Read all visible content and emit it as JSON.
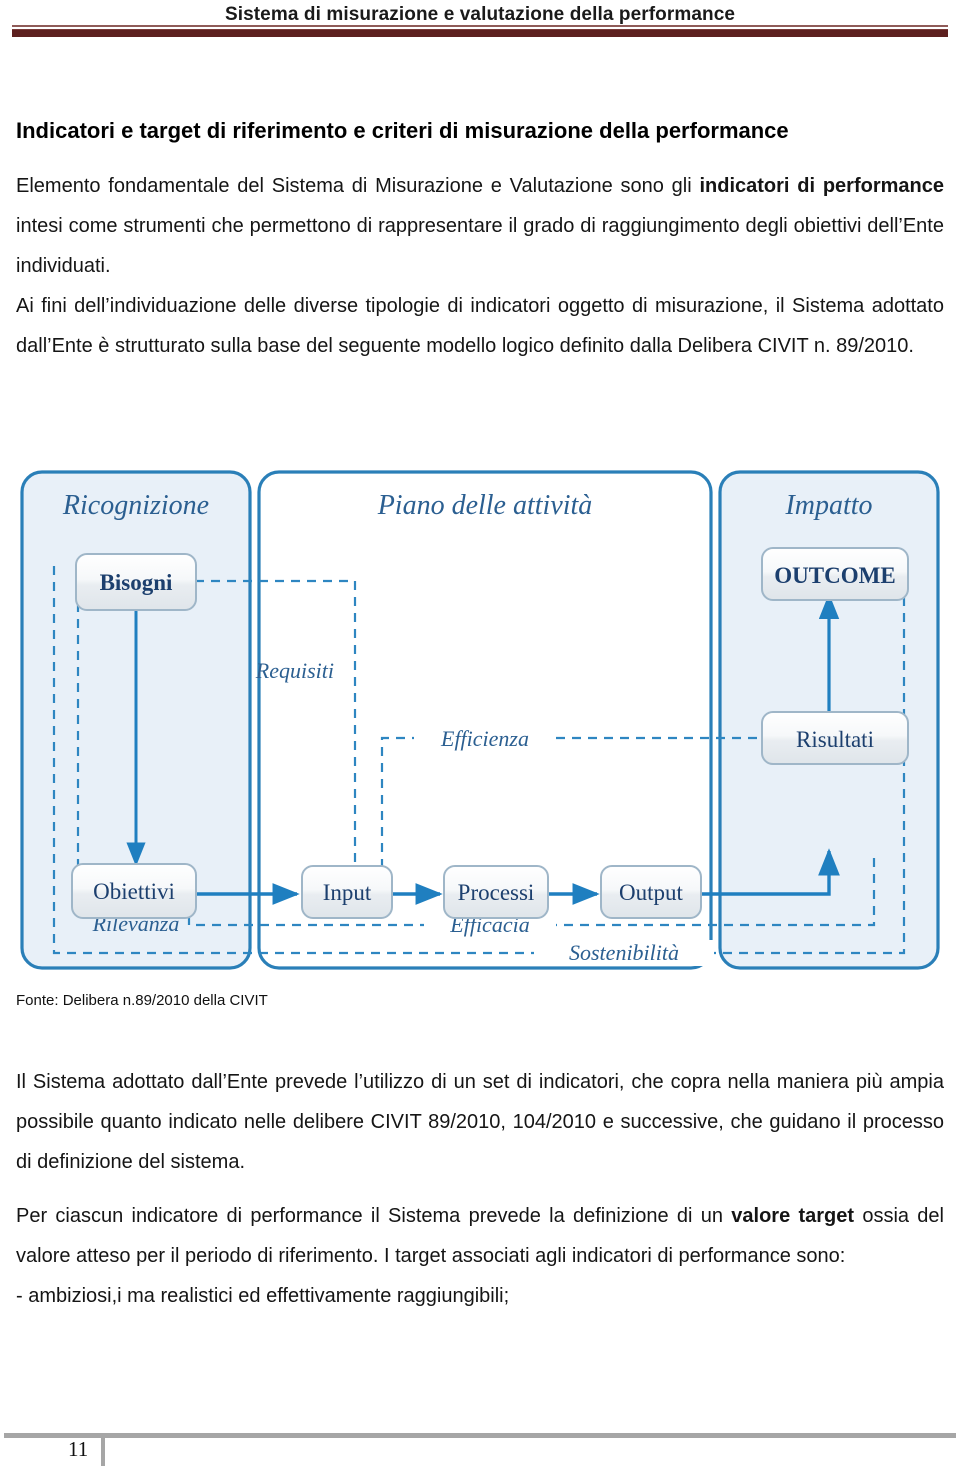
{
  "header": {
    "running_title": "Sistema di misurazione e valutazione della performance",
    "rule_color_thin": "#8f5b58",
    "rule_color_thick": "#5d201f"
  },
  "document": {
    "title": "Indicatori e target di riferimento e criteri di misurazione della performance",
    "paragraph_1_a": "Elemento fondamentale del Sistema di Misurazione e Valutazione sono gli ",
    "paragraph_1_bold": "indicatori di performance",
    "paragraph_1_b": " intesi come strumenti che permettono di rappresentare il grado di raggiungimento degli obiettivi dell’Ente individuati.",
    "paragraph_2": "Ai fini dell’individuazione delle diverse tipologie di indicatori oggetto di misurazione, il Sistema adottato dall’Ente è strutturato sulla base del seguente modello logico definito dalla Delibera CIVIT n. 89/2010.",
    "fonte": "Fonte: Delibera n.89/2010 della CIVIT",
    "paragraph_3": "Il Sistema adottato dall’Ente prevede l’utilizzo di un set di indicatori, che copra nella maniera più ampia possibile quanto indicato nelle delibere CIVIT 89/2010, 104/2010 e successive, che guidano il processo di definizione del sistema.",
    "paragraph_4_a": "Per ciascun indicatore di performance il Sistema prevede la definizione di un ",
    "paragraph_4_bold": "valore target",
    "paragraph_4_b": " ossia del valore atteso per il periodo di riferimento. I target associati agli indicatori di performance sono:",
    "bullet_1": "- ambiziosi,i ma realistici ed effettivamente raggiungibili;"
  },
  "figure": {
    "panels": [
      {
        "id": "ricognizione",
        "label": "Ricognizione",
        "fill": "#e8f0f8"
      },
      {
        "id": "piano",
        "label": "Piano delle attività",
        "fill": "#ffffff"
      },
      {
        "id": "impatto",
        "label": "Impatto",
        "fill": "#e8f0f8"
      }
    ],
    "nodes": [
      {
        "id": "bisogni",
        "label": "Bisogni",
        "bold": true,
        "panel": "ricognizione"
      },
      {
        "id": "obiettivi",
        "label": "Obiettivi",
        "bold": false,
        "panel": "ricognizione"
      },
      {
        "id": "input",
        "label": "Input",
        "bold": false,
        "panel": "piano"
      },
      {
        "id": "processi",
        "label": "Processi",
        "bold": false,
        "panel": "piano"
      },
      {
        "id": "output",
        "label": "Output",
        "bold": false,
        "panel": "piano"
      },
      {
        "id": "outcome",
        "label": "OUTCOME",
        "bold": true,
        "panel": "impatto"
      },
      {
        "id": "risultati",
        "label": "Risultati",
        "bold": false,
        "panel": "impatto"
      }
    ],
    "edge_labels": [
      {
        "id": "requisiti",
        "label": "Requisiti"
      },
      {
        "id": "efficienza",
        "label": "Efficienza"
      },
      {
        "id": "rilevanza",
        "label": "Rilevanza"
      },
      {
        "id": "efficacia",
        "label": "Efficacia"
      },
      {
        "id": "sostenibilita",
        "label": "Sostenibilità"
      }
    ],
    "colors": {
      "panel_stroke": "#2a7fb8",
      "node_stroke": "#9fb6c8",
      "node_text": "#1c3f6e",
      "arrow": "#1f7fc0",
      "dashed": "#2e86c1",
      "panel_label": "#2b5f91"
    }
  },
  "footer": {
    "page_number": "11",
    "rule_color": "#a6a6a6"
  }
}
